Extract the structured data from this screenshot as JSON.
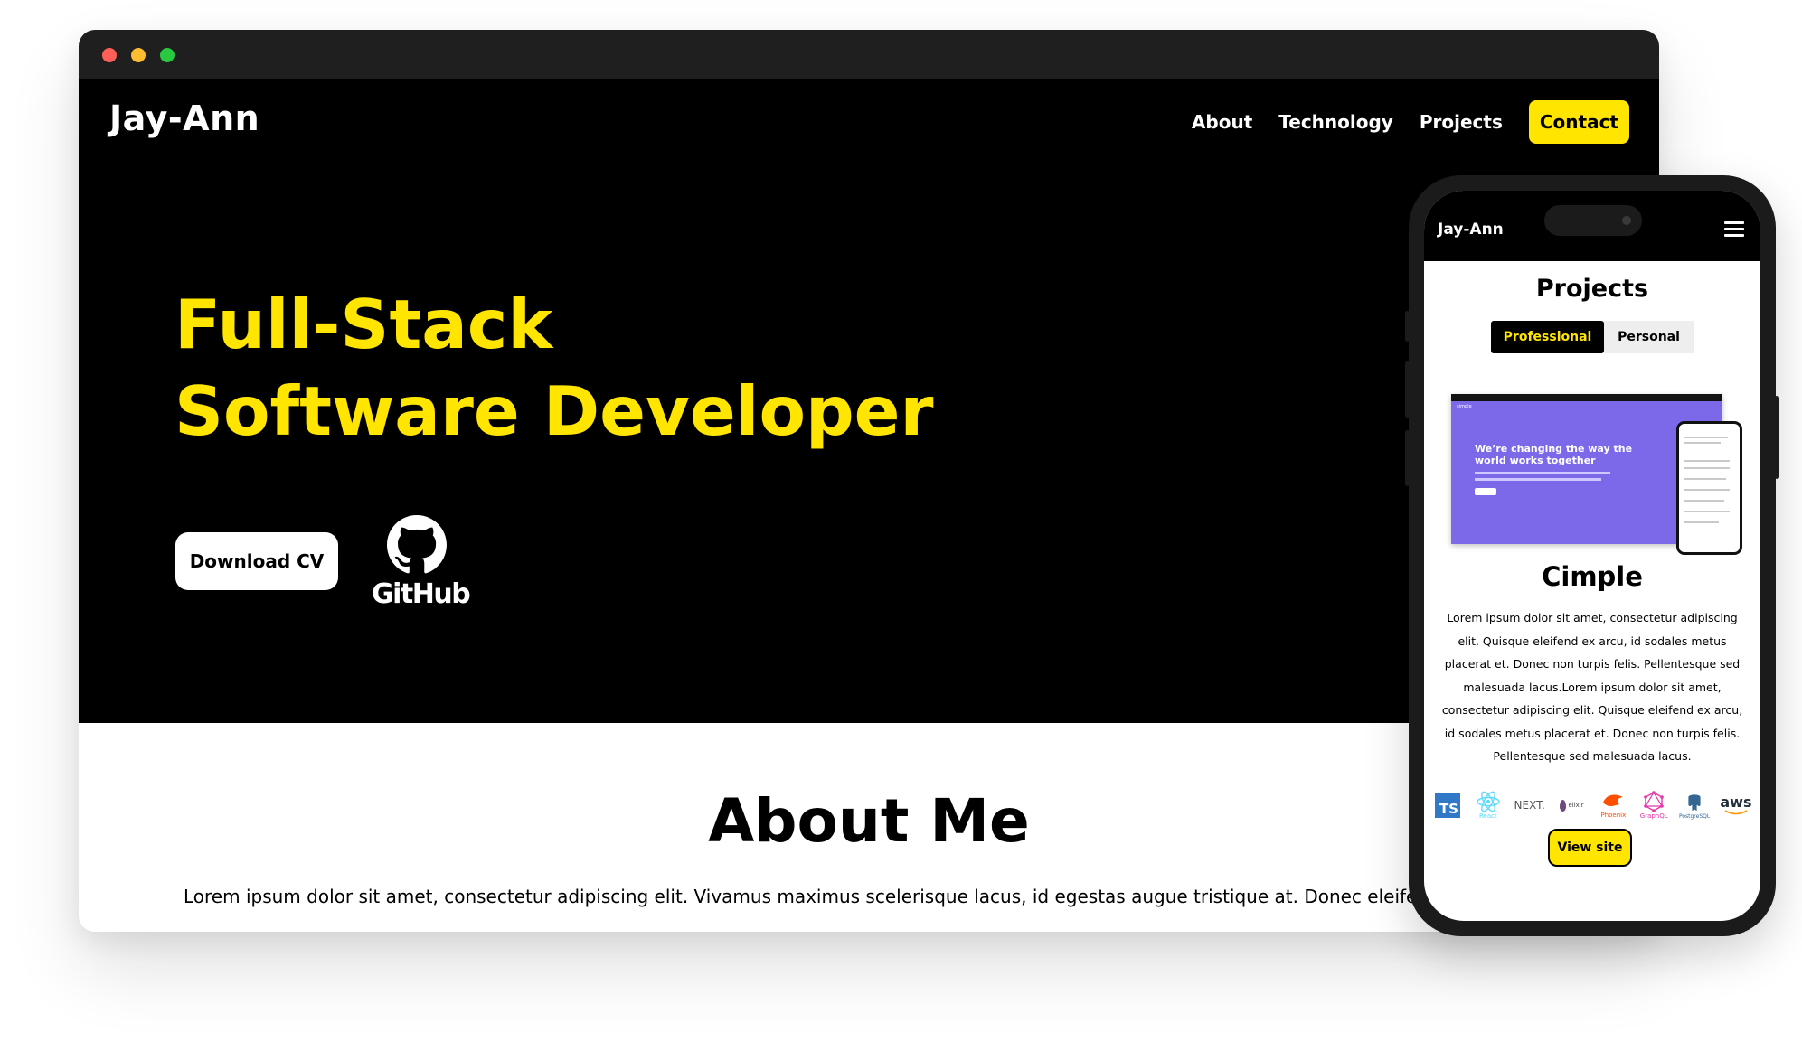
{
  "desktop": {
    "brand": "Jay-Ann",
    "nav": {
      "about": "About",
      "technology": "Technology",
      "projects": "Projects",
      "contact": "Contact"
    },
    "hero": {
      "title_line1": "Full-Stack",
      "title_line2": "Software Developer",
      "download_cv": "Download CV",
      "github_label": "GitHub"
    },
    "about": {
      "title": "About Me",
      "text": "Lorem ipsum dolor sit amet, consectetur adipiscing elit. Vivamus maximus scelerisque lacus, id egestas augue tristique at. Donec eleifend in"
    }
  },
  "mobile": {
    "brand": "Jay-Ann",
    "section_title": "Projects",
    "tabs": [
      "Professional",
      "Personal"
    ],
    "project": {
      "preview_headline": "We’re changing the way the world works together",
      "preview_logo": "cimple",
      "title": "Cimple",
      "description": "Lorem ipsum dolor sit amet, consectetur adipiscing elit. Quisque eleifend ex arcu, id sodales metus placerat et. Donec non turpis felis. Pellentesque sed malesuada lacus.Lorem ipsum dolor sit amet, consectetur adipiscing elit. Quisque eleifend ex arcu, id sodales metus placerat et. Donec non turpis felis. Pellentesque sed malesuada lacus.",
      "tech": {
        "ts": "TS",
        "react": "React",
        "next": "NEXT.",
        "elixir": "elixir",
        "phoenix": "Phoenix",
        "graphql": "GraphQL",
        "postgres": "PostgreSQL",
        "aws": "aws"
      },
      "view_site": "View site"
    }
  },
  "colors": {
    "accent": "#ffe500",
    "dark": "#000000",
    "frame": "#1f1f1f"
  }
}
